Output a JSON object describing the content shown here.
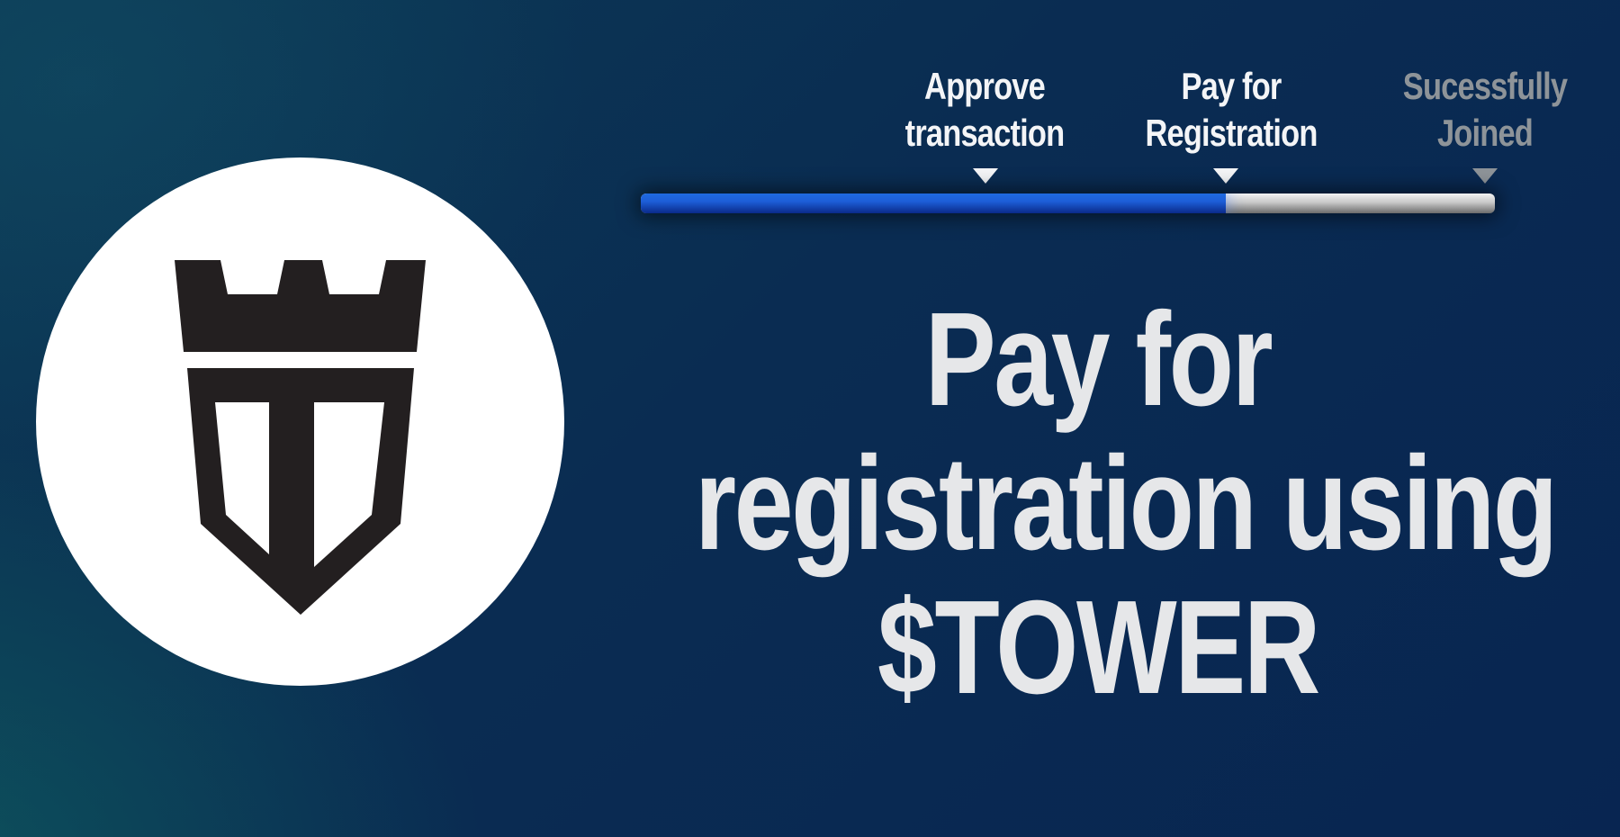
{
  "stepper": {
    "steps": [
      {
        "line1": "Approve",
        "line2": "transaction",
        "state": "complete"
      },
      {
        "line1": "Pay for",
        "line2": "Registration",
        "state": "current"
      },
      {
        "line1": "Sucessfully",
        "line2": "Joined",
        "state": "pending"
      }
    ],
    "progress_fraction": 0.685
  },
  "headline": {
    "line1": "Pay for",
    "line2": "registration using",
    "line3": "$TOWER"
  },
  "logo": {
    "icon": "tower-shield-logo-icon"
  },
  "colors": {
    "background": "#0a2c52",
    "progress_fill": "#1d5ed8",
    "progress_track": "#c8c8c8",
    "text_active": "#f4f5f7",
    "text_pending": "#8e9499",
    "logo_mark": "#231f20"
  }
}
